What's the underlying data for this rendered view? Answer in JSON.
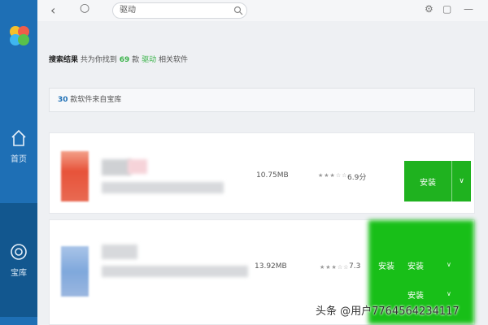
{
  "nav": {
    "home_label": "首页",
    "store_label": "宝库"
  },
  "toolbar": {
    "search_value": "驱动"
  },
  "results": {
    "prefix": "搜索结果",
    "mid": "共为你找到",
    "count": "69",
    "unit": "款",
    "keyword": "驱动",
    "suffix": "相关软件"
  },
  "source": {
    "count": "30",
    "text": "款软件来自宝库"
  },
  "apps": [
    {
      "size": "10.75MB",
      "stars": "★★★☆☆",
      "score": "6.9分",
      "install_label": "安装"
    },
    {
      "size": "13.92MB",
      "stars": "★★★☆☆",
      "score": "7.3",
      "install_label": "安装"
    }
  ],
  "watermark": "头条 @用户7764564234117",
  "colors": {
    "sidebar": "#1e6fb5",
    "accent_green": "#1fb21f",
    "count_green": "#3bb34a"
  },
  "icons": [
    "back-icon",
    "refresh-icon",
    "search-icon",
    "settings-icon",
    "skin-icon",
    "minimize-icon",
    "home-icon",
    "store-icon",
    "chevron-down-icon"
  ]
}
